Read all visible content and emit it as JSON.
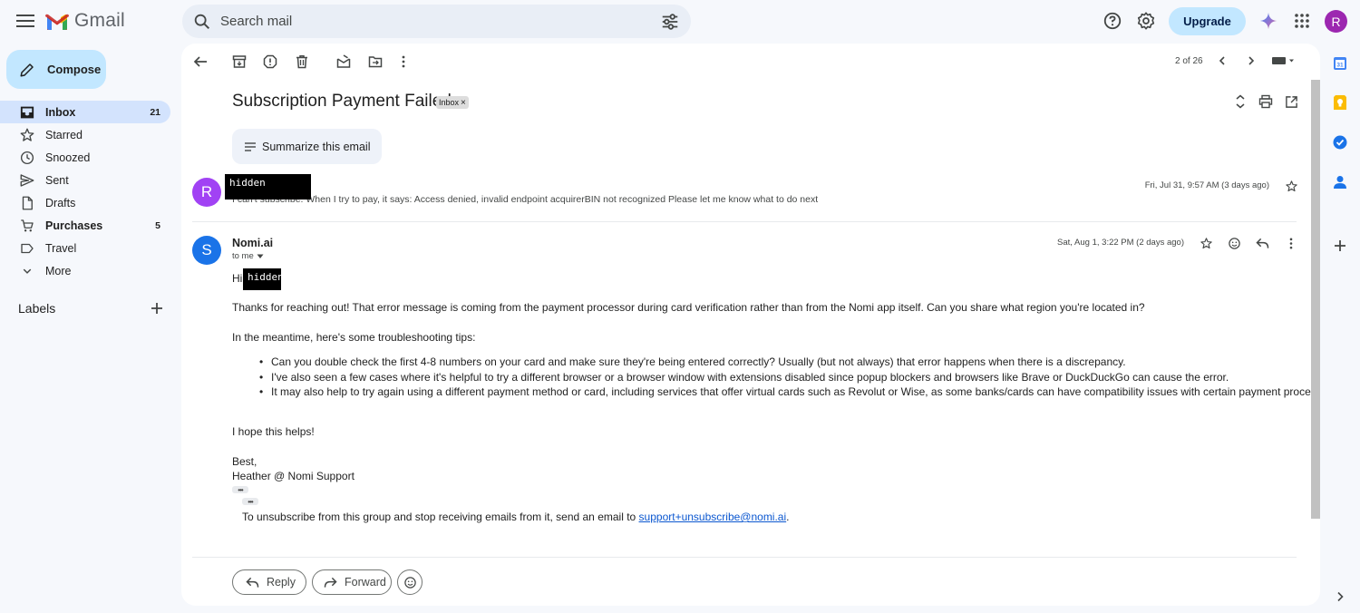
{
  "app": {
    "logo_text": "Gmail"
  },
  "search": {
    "placeholder": "Search mail"
  },
  "header": {
    "upgrade_label": "Upgrade",
    "account_initial": "R"
  },
  "sidebar": {
    "compose_label": "Compose",
    "items": [
      {
        "label": "Inbox",
        "count": "21"
      },
      {
        "label": "Starred",
        "count": ""
      },
      {
        "label": "Snoozed",
        "count": ""
      },
      {
        "label": "Sent",
        "count": ""
      },
      {
        "label": "Drafts",
        "count": ""
      },
      {
        "label": "Purchases",
        "count": "5"
      },
      {
        "label": "Travel",
        "count": ""
      },
      {
        "label": "More",
        "count": ""
      }
    ],
    "labels_heading": "Labels"
  },
  "toolbar": {
    "pager_text": "2 of 26"
  },
  "thread": {
    "subject": "Subscription Payment Failed",
    "tag_label": "Inbox",
    "summarize_label": "Summarize this email",
    "messages": [
      {
        "avatar_initial": "R",
        "avatar_color": "#a142f4",
        "sender_redacted": "hidden",
        "snippet": "I can't subscribe. When I try to pay, it says: Access denied, invalid endpoint acquirerBIN not recognized Please let me know what to do next",
        "date": "Fri, Jul 31, 9:57 AM (3 days ago)"
      },
      {
        "avatar_initial": "S",
        "avatar_color": "#1a73e8",
        "sender": "Nomi.ai",
        "to_label": "to me",
        "date": "Sat, Aug 1, 3:22 PM (2 days ago)",
        "greeting": "Hi",
        "greeting_redacted": "hidden",
        "para1": "Thanks for reaching out! That error message is coming from the payment processor during card verification rather than from the Nomi app itself. Can you share what region you're located in?",
        "para2": "In the meantime, here's some troubleshooting tips:",
        "bullets": [
          "Can you double check the first 4-8 numbers on your card and make sure they're being entered correctly? Usually (but not always) that error happens when there is a discrepancy.",
          "I've also seen a few cases where it's helpful to try a different browser or a browser window with extensions disabled since popup blockers and browsers like Brave or DuckDuckGo can cause the error.",
          "It may also help to try again using a different payment method or card, including services that offer virtual cards such as Revolut or Wise, as some banks/cards can have compatibility issues with certain payment processors."
        ],
        "closing": "I hope this helps!",
        "signoff": "Best,",
        "signature": "Heather @ Nomi Support",
        "unsubscribe_text": "To unsubscribe from this group and stop receiving emails from it, send an email to ",
        "unsubscribe_email": "support+unsubscribe@nomi.ai",
        "unsubscribe_end": "."
      }
    ],
    "reply_label": "Reply",
    "forward_label": "Forward"
  }
}
